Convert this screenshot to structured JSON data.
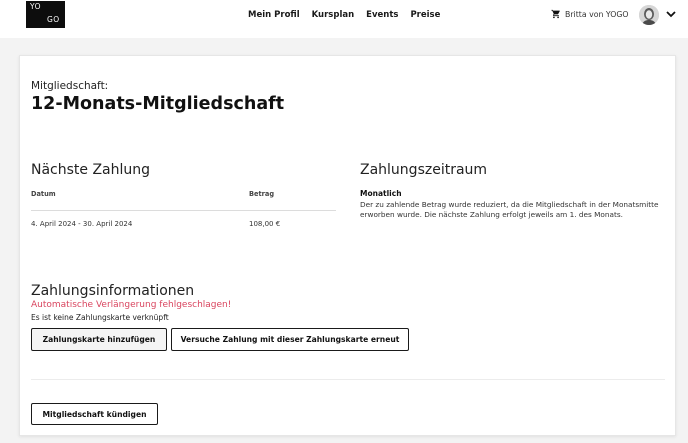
{
  "header": {
    "logo_line1": "YO",
    "logo_line2": "GO",
    "nav": [
      "Mein Profil",
      "Kursplan",
      "Events",
      "Preise"
    ],
    "user_name": "Britta von YOGO",
    "cart_icon": "cart-icon",
    "chevron_icon": "chevron-down-icon"
  },
  "membership": {
    "label": "Mitgliedschaft:",
    "title": "12-Monats-Mitgliedschaft"
  },
  "next_payment": {
    "title": "Nächste Zahlung",
    "col_date": "Datum",
    "col_amount": "Betrag",
    "date": "4. April 2024 - 30. April 2024",
    "amount": "108,00 €"
  },
  "payment_period": {
    "title": "Zahlungszeitraum",
    "type": "Monatlich",
    "note": "Der zu zahlende Betrag wurde reduziert, da die Mitgliedschaft in der Monatsmitte erworben wurde. Die nächste Zahlung erfolgt jeweils am 1. des Monats."
  },
  "payment_info": {
    "title": "Zahlungsinformationen",
    "error": "Automatische Verlängerung fehlgeschlagen!",
    "no_card": "Es ist keine Zahlungskarte verknüpft",
    "add_card_label": "Zahlungskarte hinzufügen",
    "retry_label": "Versuche Zahlung mit dieser Zahlungskarte erneut"
  },
  "cancel_label": "Mitgliedschaft kündigen",
  "colors": {
    "error": "#d9455f",
    "background": "#f3f3f3",
    "card": "#ffffff"
  }
}
